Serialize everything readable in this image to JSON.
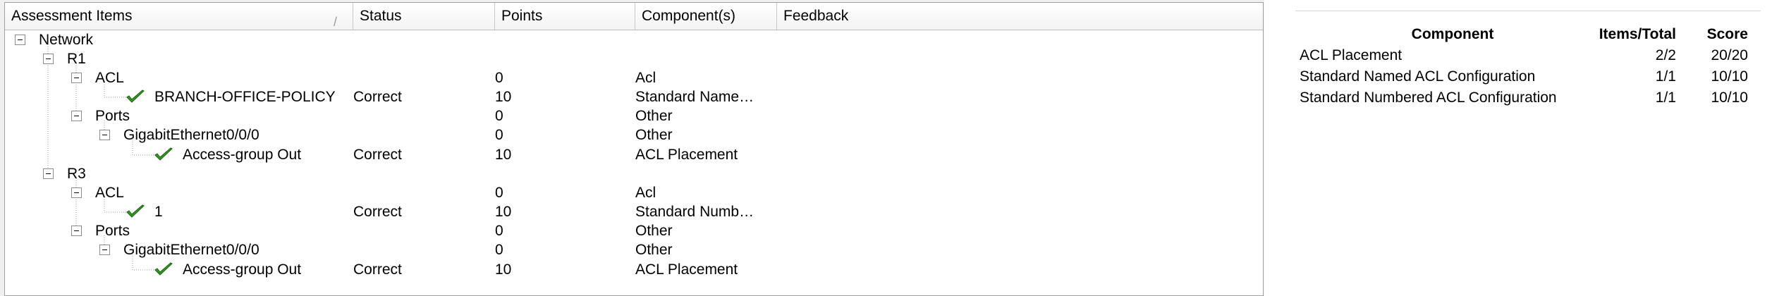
{
  "tree": {
    "columns": [
      {
        "label": "Assessment Items",
        "sort_indicator": "/"
      },
      {
        "label": "Status"
      },
      {
        "label": "Points"
      },
      {
        "label": "Component(s)"
      },
      {
        "label": "Feedback"
      }
    ],
    "rows": [
      {
        "label": "Network",
        "status": "",
        "points": "",
        "component": "",
        "feedback": ""
      },
      {
        "label": "R1",
        "status": "",
        "points": "",
        "component": "",
        "feedback": ""
      },
      {
        "label": "ACL",
        "status": "",
        "points": "0",
        "component": "Acl",
        "feedback": ""
      },
      {
        "label": "BRANCH-OFFICE-POLICY",
        "status": "Correct",
        "points": "10",
        "component": "Standard Name…",
        "feedback": "",
        "icon": "checkmark-icon"
      },
      {
        "label": "Ports",
        "status": "",
        "points": "0",
        "component": "Other",
        "feedback": ""
      },
      {
        "label": "GigabitEthernet0/0/0",
        "status": "",
        "points": "0",
        "component": "Other",
        "feedback": ""
      },
      {
        "label": "Access-group Out",
        "status": "Correct",
        "points": "10",
        "component": "ACL Placement",
        "feedback": "",
        "icon": "checkmark-icon"
      },
      {
        "label": "R3",
        "status": "",
        "points": "",
        "component": "",
        "feedback": ""
      },
      {
        "label": "ACL",
        "status": "",
        "points": "0",
        "component": "Acl",
        "feedback": ""
      },
      {
        "label": "1",
        "status": "Correct",
        "points": "10",
        "component": "Standard Numb…",
        "feedback": "",
        "icon": "checkmark-icon"
      },
      {
        "label": "Ports",
        "status": "",
        "points": "0",
        "component": "Other",
        "feedback": ""
      },
      {
        "label": "GigabitEthernet0/0/0",
        "status": "",
        "points": "0",
        "component": "Other",
        "feedback": ""
      },
      {
        "label": "Access-group Out",
        "status": "Correct",
        "points": "10",
        "component": "ACL Placement",
        "feedback": "",
        "icon": "checkmark-icon"
      }
    ]
  },
  "summary": {
    "headers": {
      "component": "Component",
      "items_total": "Items/Total",
      "score": "Score"
    },
    "rows": [
      {
        "component": "ACL Placement",
        "items_total": "2/2",
        "score": "20/20"
      },
      {
        "component": "Standard Named ACL Configuration",
        "items_total": "1/1",
        "score": "10/10"
      },
      {
        "component": "Standard Numbered ACL Configuration",
        "items_total": "1/1",
        "score": "10/10"
      }
    ]
  },
  "colors": {
    "check_green": "#2e9e1f",
    "check_dark": "#1d5f14",
    "panel_border": "#a0a0a0",
    "tree_line": "#9a9a9a"
  }
}
